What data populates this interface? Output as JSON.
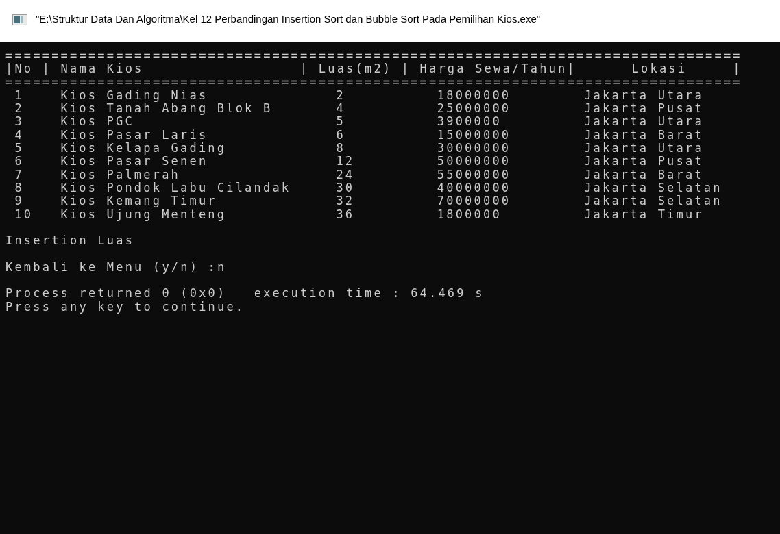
{
  "window": {
    "title": "\"E:\\Struktur Data Dan Algoritma\\Kel 12 Perbandingan Insertion Sort dan Bubble Sort Pada Pemilihan Kios.exe\""
  },
  "console": {
    "separator_top": "================================================================================",
    "header": "|No | Nama Kios                 | Luas(m2) | Harga Sewa/Tahun|      Lokasi     |",
    "separator_bottom": "================================================================================",
    "rows": [
      {
        "no": "1",
        "name": "Kios Gading Nias",
        "luas": "2",
        "harga": "18000000",
        "lokasi": "Jakarta Utara"
      },
      {
        "no": "2",
        "name": "Kios Tanah Abang Blok B",
        "luas": "4",
        "harga": "25000000",
        "lokasi": "Jakarta Pusat"
      },
      {
        "no": "3",
        "name": "Kios PGC",
        "luas": "5",
        "harga": "3900000",
        "lokasi": "Jakarta Utara"
      },
      {
        "no": "4",
        "name": "Kios Pasar Laris",
        "luas": "6",
        "harga": "15000000",
        "lokasi": "Jakarta Barat"
      },
      {
        "no": "5",
        "name": "Kios Kelapa Gading",
        "luas": "8",
        "harga": "30000000",
        "lokasi": "Jakarta Utara"
      },
      {
        "no": "6",
        "name": "Kios Pasar Senen",
        "luas": "12",
        "harga": "50000000",
        "lokasi": "Jakarta Pusat"
      },
      {
        "no": "7",
        "name": "Kios Palmerah",
        "luas": "24",
        "harga": "55000000",
        "lokasi": "Jakarta Barat"
      },
      {
        "no": "8",
        "name": "Kios Pondok Labu Cilandak",
        "luas": "30",
        "harga": "40000000",
        "lokasi": "Jakarta Selatan"
      },
      {
        "no": "9",
        "name": "Kios Kemang Timur",
        "luas": "32",
        "harga": "70000000",
        "lokasi": "Jakarta Selatan"
      },
      {
        "no": "10",
        "name": "Kios Ujung Menteng",
        "luas": "36",
        "harga": "1800000",
        "lokasi": "Jakarta Timur"
      }
    ],
    "output_blocks": [
      [
        "Insertion Luas"
      ],
      [
        "Kembali ke Menu (y/n) :n"
      ],
      [
        "Process returned 0 (0x0)   execution time : 64.469 s",
        "Press any key to continue."
      ]
    ]
  }
}
